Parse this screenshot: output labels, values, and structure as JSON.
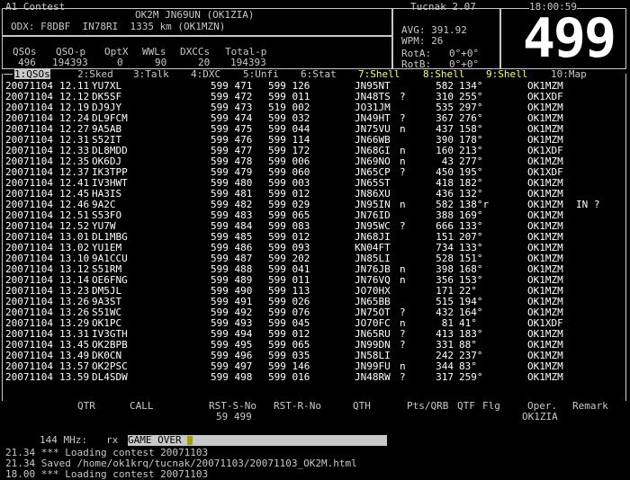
{
  "header": {
    "title": "A1 Contest",
    "app": "Tucnak 2.07",
    "clock": "18:00:59",
    "callsign_line": "OK2M JN69UN (OK1ZIA)",
    "odx": "ODX: F8DBF  IN78RI  1335 km (OK1MZN)"
  },
  "stats": {
    "labels": [
      "QSOs",
      "QSO-p",
      "OptX",
      "WWLs",
      "DXCCs",
      "Total-p"
    ],
    "values": [
      "496",
      "194393",
      "0",
      "90",
      "20",
      "194393"
    ],
    "avg": "AVG: 391.92",
    "wpm": "WPM: 26",
    "rota": "RotA:   0°+0°",
    "rotb": "RotB:   0°+0°",
    "big_number": "499"
  },
  "tabs": [
    {
      "label": "1:QSOs",
      "style": "active"
    },
    {
      "label": "2:Sked",
      "style": "normal"
    },
    {
      "label": "3:Talk",
      "style": "normal"
    },
    {
      "label": "4:DXC",
      "style": "normal"
    },
    {
      "label": "5:Unfi",
      "style": "normal"
    },
    {
      "label": "6:Stat",
      "style": "normal"
    },
    {
      "label": "7:Shell",
      "style": "yel"
    },
    {
      "label": "8:Shell",
      "style": "yel"
    },
    {
      "label": "9:Shell",
      "style": "yel"
    },
    {
      "label": "10:Map",
      "style": "normal"
    }
  ],
  "qsos": [
    [
      "20071104",
      "12.11",
      "YU7XL",
      "599 471",
      "599 126",
      "JN95NT",
      "",
      "582",
      "134°",
      "OK1MZM",
      ""
    ],
    [
      "20071104",
      "12.12",
      "DK5SF",
      "599 472",
      "599 011",
      "JN48TS",
      "?",
      "310",
      "255°",
      "OK1XDF",
      ""
    ],
    [
      "20071104",
      "12.19",
      "DJ9JY",
      "599 473",
      "519 002",
      "JO31JM",
      "",
      "535",
      "297°",
      "OK1MZM",
      ""
    ],
    [
      "20071104",
      "12.24",
      "DL9FCM",
      "599 474",
      "599 032",
      "JN49HT",
      "?",
      "367",
      "276°",
      "OK1MZM",
      ""
    ],
    [
      "20071104",
      "12.27",
      "9A5AB",
      "599 475",
      "599 044",
      "JN75VU",
      "n",
      "437",
      "158°",
      "OK1MZM",
      ""
    ],
    [
      "20071104",
      "12.31",
      "S52IT",
      "599 476",
      "599 114",
      "JN66WB",
      "",
      "390",
      "178°",
      "OK1MZM",
      ""
    ],
    [
      "20071104",
      "12.33",
      "DL8MDD",
      "599 477",
      "599 172",
      "JN68GI",
      "n",
      "160",
      "213°",
      "OK1XDF",
      ""
    ],
    [
      "20071104",
      "12.35",
      "OK6DJ",
      "599 478",
      "599 006",
      "JN69NO",
      "n",
      "43",
      "277°",
      "OK1MZM",
      ""
    ],
    [
      "20071104",
      "12.37",
      "IK3TPP",
      "599 479",
      "599 060",
      "JN65CP",
      "?",
      "450",
      "195°",
      "OK1XDF",
      ""
    ],
    [
      "20071104",
      "12.41",
      "IV3HWT",
      "599 480",
      "599 003",
      "JN65ST",
      "",
      "418",
      "182°",
      "OK1MZM",
      ""
    ],
    [
      "20071104",
      "12.45",
      "HA3IS",
      "599 481",
      "599 012",
      "JN86XU",
      "",
      "436",
      "132°",
      "OK1MZM",
      ""
    ],
    [
      "20071104",
      "12.46",
      "9A2C",
      "599 482",
      "599 029",
      "JN95IN",
      "n",
      "582",
      "138°r",
      "OK1MZM",
      "IN ?"
    ],
    [
      "20071104",
      "12.51",
      "S53FO",
      "599 483",
      "599 065",
      "JN76ID",
      "",
      "388",
      "169°",
      "OK1MZM",
      ""
    ],
    [
      "20071104",
      "12.52",
      "YU7W",
      "599 484",
      "599 083",
      "JN95WC",
      "?",
      "666",
      "133°",
      "OK1MZM",
      ""
    ],
    [
      "20071104",
      "13.01",
      "DL1MBG",
      "599 485",
      "599 012",
      "JN68JI",
      "",
      "151",
      "207°",
      "OK1MZM",
      ""
    ],
    [
      "20071104",
      "13.02",
      "YU1EM",
      "599 486",
      "599 093",
      "KN04FT",
      "",
      "734",
      "133°",
      "OK1MZM",
      ""
    ],
    [
      "20071104",
      "13.10",
      "9A1CCU",
      "599 487",
      "599 202",
      "JN85LI",
      "",
      "528",
      "151°",
      "OK1MZM",
      ""
    ],
    [
      "20071104",
      "13.12",
      "S51RM",
      "599 488",
      "599 041",
      "JN76JB",
      "n",
      "398",
      "168°",
      "OK1MZM",
      ""
    ],
    [
      "20071104",
      "13.14",
      "OE6FNG",
      "599 489",
      "599 011",
      "JN76VQ",
      "n",
      "356",
      "153°",
      "OK1MZM",
      ""
    ],
    [
      "20071104",
      "13.23",
      "DM5JL",
      "599 490",
      "599 113",
      "JO70HX",
      "",
      "171",
      "22°",
      "OK1MZM",
      ""
    ],
    [
      "20071104",
      "13.26",
      "9A3ST",
      "599 491",
      "599 026",
      "JN65BB",
      "",
      "515",
      "194°",
      "OK1MZM",
      ""
    ],
    [
      "20071104",
      "13.26",
      "S51WC",
      "599 492",
      "599 076",
      "JN75OT",
      "?",
      "432",
      "164°",
      "OK1MZM",
      ""
    ],
    [
      "20071104",
      "13.29",
      "OK1PC",
      "599 493",
      "599 045",
      "JO70FC",
      "n",
      "81",
      "41°",
      "OK1XDF",
      ""
    ],
    [
      "20071104",
      "13.31",
      "IV3GTH",
      "599 494",
      "599 012",
      "JN65RU",
      "?",
      "413",
      "183°",
      "OK1MZM",
      ""
    ],
    [
      "20071104",
      "13.45",
      "OK2BPB",
      "599 495",
      "599 065",
      "JN99DN",
      "?",
      "331",
      "88°",
      "OK1MZM",
      ""
    ],
    [
      "20071104",
      "13.49",
      "DK0CN",
      "599 496",
      "599 035",
      "JN58LI",
      "",
      "242",
      "237°",
      "OK1MZM",
      ""
    ],
    [
      "20071104",
      "13.57",
      "OK2PSC",
      "599 497",
      "599 146",
      "JN99FU",
      "n",
      "344",
      "83°",
      "OK1MZM",
      ""
    ],
    [
      "20071104",
      "13.59",
      "DL4SDW",
      "599 498",
      "599 016",
      "JN48RW",
      "?",
      "317",
      "259°",
      "OK1MZM",
      ""
    ]
  ],
  "input_labels": {
    "qtr": "QTR",
    "call": "CALL",
    "rsts": "RST-S-No",
    "rstr": "RST-R-No",
    "qth": "QTH",
    "ptsqrb": "Pts/QRB",
    "qtf": "QTF",
    "flg": "Flg",
    "oper": "Oper.",
    "remark": "Remark",
    "rst_value": "59 499",
    "oper_value": "OK1ZIA"
  },
  "band": {
    "label": "144 MHz:",
    "mode": "rx",
    "entry": "GAME OVER"
  },
  "log": [
    "21.34 *** Loading contest 20071103",
    "21.34 Saved /home/ok1krq/tucnak/20071103/20071103_OK2M.html",
    "18.00 *** Loading contest 20071103"
  ]
}
